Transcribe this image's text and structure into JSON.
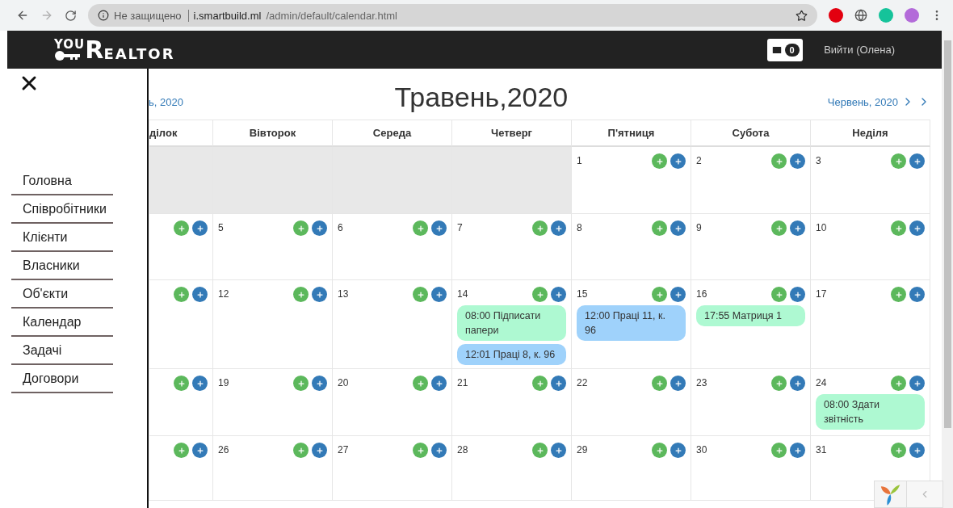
{
  "browser": {
    "security": "Не защищено",
    "url_host": "i.smartbuild.ml",
    "url_path": "/admin/default/calendar.html"
  },
  "header": {
    "logo_top": "YOU",
    "logo_initial": "R",
    "logo_rest": "EALTOR",
    "messages_count": "0",
    "logout": "Вийти (Олена)"
  },
  "sidebar": {
    "items": [
      {
        "label": "Головна"
      },
      {
        "label": "Співробітники"
      },
      {
        "label": "Клієнти"
      },
      {
        "label": "Власники"
      },
      {
        "label": "Об'єкти"
      },
      {
        "label": "Календар"
      },
      {
        "label": "Задачі"
      },
      {
        "label": "Договори"
      }
    ]
  },
  "calendar": {
    "prev": "ь, 2020",
    "title": "Травень,2020",
    "next": "Червень, 2020",
    "weekdays": [
      "ділок",
      "Вівторок",
      "Середа",
      "Четверг",
      "П'ятниця",
      "Субота",
      "Неділя"
    ],
    "weeks": [
      [
        {
          "kind": "blank"
        },
        {
          "kind": "blank"
        },
        {
          "kind": "blank"
        },
        {
          "kind": "blank"
        },
        {
          "kind": "day",
          "day": "1"
        },
        {
          "kind": "day",
          "day": "2"
        },
        {
          "kind": "day",
          "day": "3"
        }
      ],
      [
        {
          "kind": "day"
        },
        {
          "kind": "day",
          "day": "5"
        },
        {
          "kind": "day",
          "day": "6"
        },
        {
          "kind": "day",
          "day": "7"
        },
        {
          "kind": "day",
          "day": "8"
        },
        {
          "kind": "day",
          "day": "9"
        },
        {
          "kind": "day",
          "day": "10"
        }
      ],
      [
        {
          "kind": "day"
        },
        {
          "kind": "day",
          "day": "12"
        },
        {
          "kind": "day",
          "day": "13"
        },
        {
          "kind": "day",
          "day": "14",
          "events": [
            {
              "text": "08:00 Підписати папери",
              "color": "#aef9d2"
            },
            {
              "text": "12:01 Праці 8, к. 96",
              "color": "#9fd2fb"
            }
          ]
        },
        {
          "kind": "day",
          "day": "15",
          "events": [
            {
              "text": "12:00 Праці 11, к. 96",
              "color": "#9fd2fb"
            }
          ]
        },
        {
          "kind": "day",
          "day": "16",
          "events": [
            {
              "text": "17:55 Матриця 1",
              "color": "#aef9d2"
            }
          ]
        },
        {
          "kind": "day",
          "day": "17"
        }
      ],
      [
        {
          "kind": "day"
        },
        {
          "kind": "day",
          "day": "19"
        },
        {
          "kind": "day",
          "day": "20"
        },
        {
          "kind": "day",
          "day": "21"
        },
        {
          "kind": "day",
          "day": "22"
        },
        {
          "kind": "day",
          "day": "23"
        },
        {
          "kind": "day",
          "day": "24",
          "events": [
            {
              "text": "08:00 Здати звітність",
              "color": "#aef9d2"
            }
          ]
        }
      ],
      [
        {
          "kind": "day"
        },
        {
          "kind": "day",
          "day": "26"
        },
        {
          "kind": "day",
          "day": "27"
        },
        {
          "kind": "day",
          "day": "28"
        },
        {
          "kind": "day",
          "day": "29"
        },
        {
          "kind": "day",
          "day": "30"
        },
        {
          "kind": "day",
          "day": "31"
        }
      ]
    ]
  }
}
